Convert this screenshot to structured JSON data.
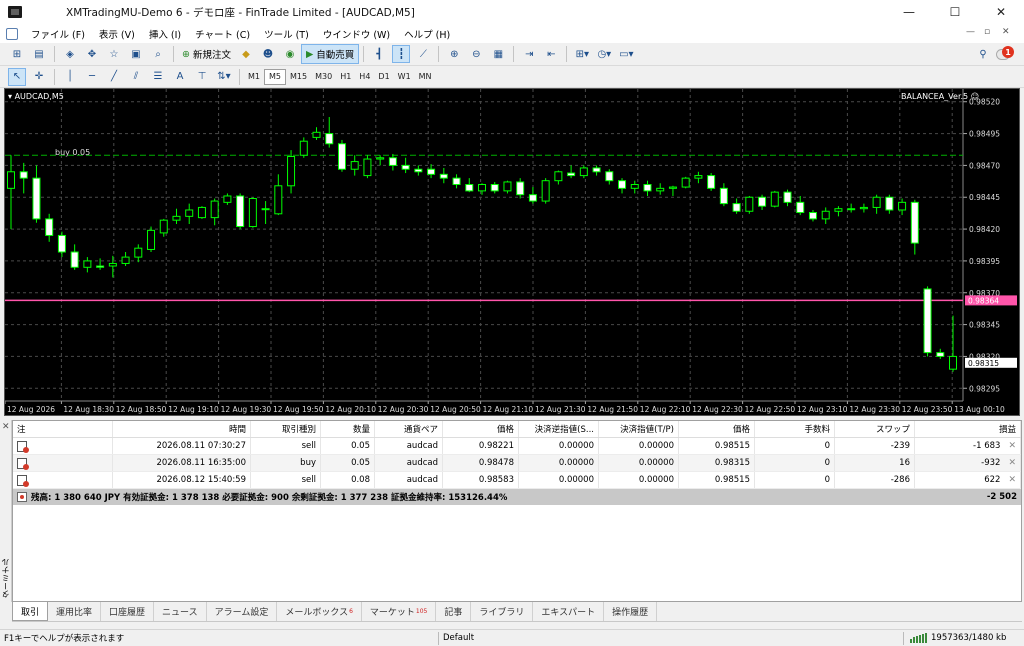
{
  "window": {
    "title": "XMTradingMU-Demo 6 - デモロ座 - FinTrade Limited - [AUDCAD,M5]",
    "minimize": "—",
    "maximize": "☐",
    "close": "✕"
  },
  "menu": {
    "items": [
      "ファイル (F)",
      "表示 (V)",
      "挿入 (I)",
      "チャート (C)",
      "ツール (T)",
      "ウインドウ (W)",
      "ヘルプ (H)"
    ],
    "doc_controls": [
      "—",
      "▫",
      "✕"
    ],
    "notification_count": "1"
  },
  "toolbar1": {
    "new_order": "新規注文",
    "auto_trade": "自動売買"
  },
  "toolbar2": {
    "timeframes": [
      "M1",
      "M5",
      "M15",
      "M30",
      "H1",
      "H4",
      "D1",
      "W1",
      "MN"
    ],
    "active_timeframe": "M5",
    "text_tool": "A"
  },
  "chart": {
    "symbol_label": "AUDCAD,M5",
    "expert_label": "BALANCEA_Ver.5",
    "position_label": "buy 0.05",
    "ask_price": "0.98364",
    "bid_price": "0.98315",
    "price_levels": [
      "0.98520",
      "0.98495",
      "0.98470",
      "0.98445",
      "0.98420",
      "0.98395",
      "0.98370",
      "0.98345",
      "0.98320",
      "0.98295"
    ],
    "time_labels": [
      "12 Aug 2026",
      "12 Aug 18:30",
      "12 Aug 18:50",
      "12 Aug 19:10",
      "12 Aug 19:30",
      "12 Aug 19:50",
      "12 Aug 20:10",
      "12 Aug 20:30",
      "12 Aug 20:50",
      "12 Aug 21:10",
      "12 Aug 21:30",
      "12 Aug 21:50",
      "12 Aug 22:10",
      "12 Aug 22:30",
      "12 Aug 22:50",
      "12 Aug 23:10",
      "12 Aug 23:30",
      "12 Aug 23:50",
      "13 Aug 00:10"
    ],
    "colors": {
      "bull": "#00ff00",
      "bear": "#ffffff",
      "ask_line": "#ff55aa",
      "buy_line": "#00b000",
      "grid": "#4a4a4a"
    }
  },
  "chart_data": {
    "type": "candlestick",
    "title": "AUDCAD,M5",
    "ylim": [
      0.98285,
      0.9853
    ],
    "ohlc": [
      [
        0.98452,
        0.98478,
        0.9842,
        0.98465
      ],
      [
        0.98465,
        0.98472,
        0.98448,
        0.9846
      ],
      [
        0.9846,
        0.9847,
        0.98425,
        0.98428
      ],
      [
        0.98428,
        0.98432,
        0.9841,
        0.98415
      ],
      [
        0.98415,
        0.98418,
        0.98398,
        0.98402
      ],
      [
        0.98402,
        0.98408,
        0.98388,
        0.9839
      ],
      [
        0.9839,
        0.98398,
        0.98386,
        0.98395
      ],
      [
        0.98391,
        0.98397,
        0.98388,
        0.9839
      ],
      [
        0.98391,
        0.98399,
        0.98382,
        0.98393
      ],
      [
        0.98393,
        0.98402,
        0.98391,
        0.98398
      ],
      [
        0.98398,
        0.98408,
        0.98394,
        0.98405
      ],
      [
        0.98404,
        0.98422,
        0.98402,
        0.98419
      ],
      [
        0.98417,
        0.98428,
        0.98414,
        0.98427
      ],
      [
        0.98427,
        0.98436,
        0.98424,
        0.9843
      ],
      [
        0.9843,
        0.9844,
        0.98424,
        0.98435
      ],
      [
        0.98429,
        0.98438,
        0.98428,
        0.98437
      ],
      [
        0.98429,
        0.98444,
        0.98423,
        0.98442
      ],
      [
        0.98441,
        0.98448,
        0.98439,
        0.98446
      ],
      [
        0.98446,
        0.98448,
        0.9842,
        0.98422
      ],
      [
        0.98422,
        0.98445,
        0.98421,
        0.98444
      ],
      [
        0.98436,
        0.98442,
        0.98424,
        0.98436
      ],
      [
        0.98432,
        0.98463,
        0.98431,
        0.98454
      ],
      [
        0.98454,
        0.98482,
        0.98448,
        0.98477
      ],
      [
        0.98478,
        0.98492,
        0.98476,
        0.98489
      ],
      [
        0.98492,
        0.985,
        0.9849,
        0.98496
      ],
      [
        0.98495,
        0.98508,
        0.98484,
        0.98487
      ],
      [
        0.98487,
        0.9849,
        0.98465,
        0.98467
      ],
      [
        0.98467,
        0.98478,
        0.98462,
        0.98473
      ],
      [
        0.98462,
        0.98478,
        0.9846,
        0.98475
      ],
      [
        0.98475,
        0.98478,
        0.9847,
        0.98476
      ],
      [
        0.98476,
        0.98479,
        0.98466,
        0.9847
      ],
      [
        0.9847,
        0.98476,
        0.98464,
        0.98467
      ],
      [
        0.98467,
        0.9847,
        0.98462,
        0.98465
      ],
      [
        0.98467,
        0.98471,
        0.9846,
        0.98463
      ],
      [
        0.98463,
        0.98468,
        0.98456,
        0.9846
      ],
      [
        0.9846,
        0.98463,
        0.98452,
        0.98455
      ],
      [
        0.98455,
        0.9846,
        0.98449,
        0.9845
      ],
      [
        0.9845,
        0.98456,
        0.98447,
        0.98455
      ],
      [
        0.98455,
        0.98457,
        0.98448,
        0.9845
      ],
      [
        0.9845,
        0.98458,
        0.98448,
        0.98457
      ],
      [
        0.98457,
        0.9846,
        0.98444,
        0.98447
      ],
      [
        0.98447,
        0.98453,
        0.9844,
        0.98442
      ],
      [
        0.98442,
        0.9846,
        0.9844,
        0.98458
      ],
      [
        0.98458,
        0.98466,
        0.98455,
        0.98465
      ],
      [
        0.98464,
        0.9847,
        0.9846,
        0.98462
      ],
      [
        0.98462,
        0.9847,
        0.9846,
        0.98468
      ],
      [
        0.98468,
        0.9847,
        0.98462,
        0.98465
      ],
      [
        0.98465,
        0.98467,
        0.98455,
        0.98458
      ],
      [
        0.98458,
        0.9846,
        0.98448,
        0.98452
      ],
      [
        0.98452,
        0.98458,
        0.98448,
        0.98455
      ],
      [
        0.98455,
        0.98458,
        0.98446,
        0.9845
      ],
      [
        0.9845,
        0.98456,
        0.98447,
        0.98452
      ],
      [
        0.98452,
        0.98454,
        0.98446,
        0.98453
      ],
      [
        0.98453,
        0.98461,
        0.98452,
        0.9846
      ],
      [
        0.9846,
        0.98465,
        0.98456,
        0.98462
      ],
      [
        0.98462,
        0.98464,
        0.9845,
        0.98452
      ],
      [
        0.98452,
        0.98456,
        0.98438,
        0.9844
      ],
      [
        0.9844,
        0.98444,
        0.98432,
        0.98434
      ],
      [
        0.98434,
        0.98446,
        0.98432,
        0.98445
      ],
      [
        0.98445,
        0.98447,
        0.98435,
        0.98438
      ],
      [
        0.98438,
        0.9845,
        0.98437,
        0.98449
      ],
      [
        0.98449,
        0.98451,
        0.98438,
        0.98441
      ],
      [
        0.98441,
        0.98446,
        0.98431,
        0.98433
      ],
      [
        0.98433,
        0.98435,
        0.98426,
        0.98428
      ],
      [
        0.98428,
        0.98437,
        0.98424,
        0.98434
      ],
      [
        0.98434,
        0.98438,
        0.9843,
        0.98436
      ],
      [
        0.98436,
        0.9844,
        0.98433,
        0.98436
      ],
      [
        0.98436,
        0.9844,
        0.98433,
        0.98437
      ],
      [
        0.98437,
        0.98447,
        0.98432,
        0.98445
      ],
      [
        0.98445,
        0.98447,
        0.98432,
        0.98435
      ],
      [
        0.98435,
        0.98444,
        0.98431,
        0.98441
      ],
      [
        0.98441,
        0.98443,
        0.984,
        0.98409
      ],
      [
        0.98373,
        0.98375,
        0.9832,
        0.98323
      ],
      [
        0.98323,
        0.98326,
        0.98318,
        0.9832
      ],
      [
        0.9831,
        0.98352,
        0.98308,
        0.9832
      ]
    ]
  },
  "terminal": {
    "side_label": "ターミナル",
    "columns": [
      "注",
      "時間",
      "取引種別",
      "数量",
      "通貨ペア",
      "価格",
      "決済逆指値(S...",
      "決済指値(T/P)",
      "価格",
      "手数料",
      "スワップ",
      "損益"
    ],
    "rows": [
      {
        "time": "2026.08.11 07:30:27",
        "type": "sell",
        "volume": "0.05",
        "symbol": "audcad",
        "price": "0.98221",
        "sl": "0.00000",
        "tp": "0.00000",
        "current": "0.98515",
        "commission": "0",
        "swap": "-239",
        "profit": "-1 683"
      },
      {
        "time": "2026.08.11 16:35:00",
        "type": "buy",
        "volume": "0.05",
        "symbol": "audcad",
        "price": "0.98478",
        "sl": "0.00000",
        "tp": "0.00000",
        "current": "0.98315",
        "commission": "0",
        "swap": "16",
        "profit": "-932"
      },
      {
        "time": "2026.08.12 15:40:59",
        "type": "sell",
        "volume": "0.08",
        "symbol": "audcad",
        "price": "0.98583",
        "sl": "0.00000",
        "tp": "0.00000",
        "current": "0.98515",
        "commission": "0",
        "swap": "-286",
        "profit": "622"
      }
    ],
    "summary": "残高: 1 380 640 JPY  有効証拠金: 1 378 138  必要証拠金: 900  余剰証拠金: 1 377 238  証拠金維持率: 153126.44%",
    "summary_profit": "-2 502",
    "close_glyph": "✕"
  },
  "tabs": [
    {
      "label": "取引",
      "badge": ""
    },
    {
      "label": "運用比率",
      "badge": ""
    },
    {
      "label": "口座履歴",
      "badge": ""
    },
    {
      "label": "ニュース",
      "badge": ""
    },
    {
      "label": "アラーム設定",
      "badge": ""
    },
    {
      "label": "メールボックス",
      "badge": "6"
    },
    {
      "label": "マーケット",
      "badge": "105"
    },
    {
      "label": "記事",
      "badge": ""
    },
    {
      "label": "ライブラリ",
      "badge": ""
    },
    {
      "label": "エキスパート",
      "badge": ""
    },
    {
      "label": "操作履歴",
      "badge": ""
    }
  ],
  "status": {
    "help": "F1キーでヘルプが表示されます",
    "profile": "Default",
    "traffic": "1957363/1480 kb"
  }
}
